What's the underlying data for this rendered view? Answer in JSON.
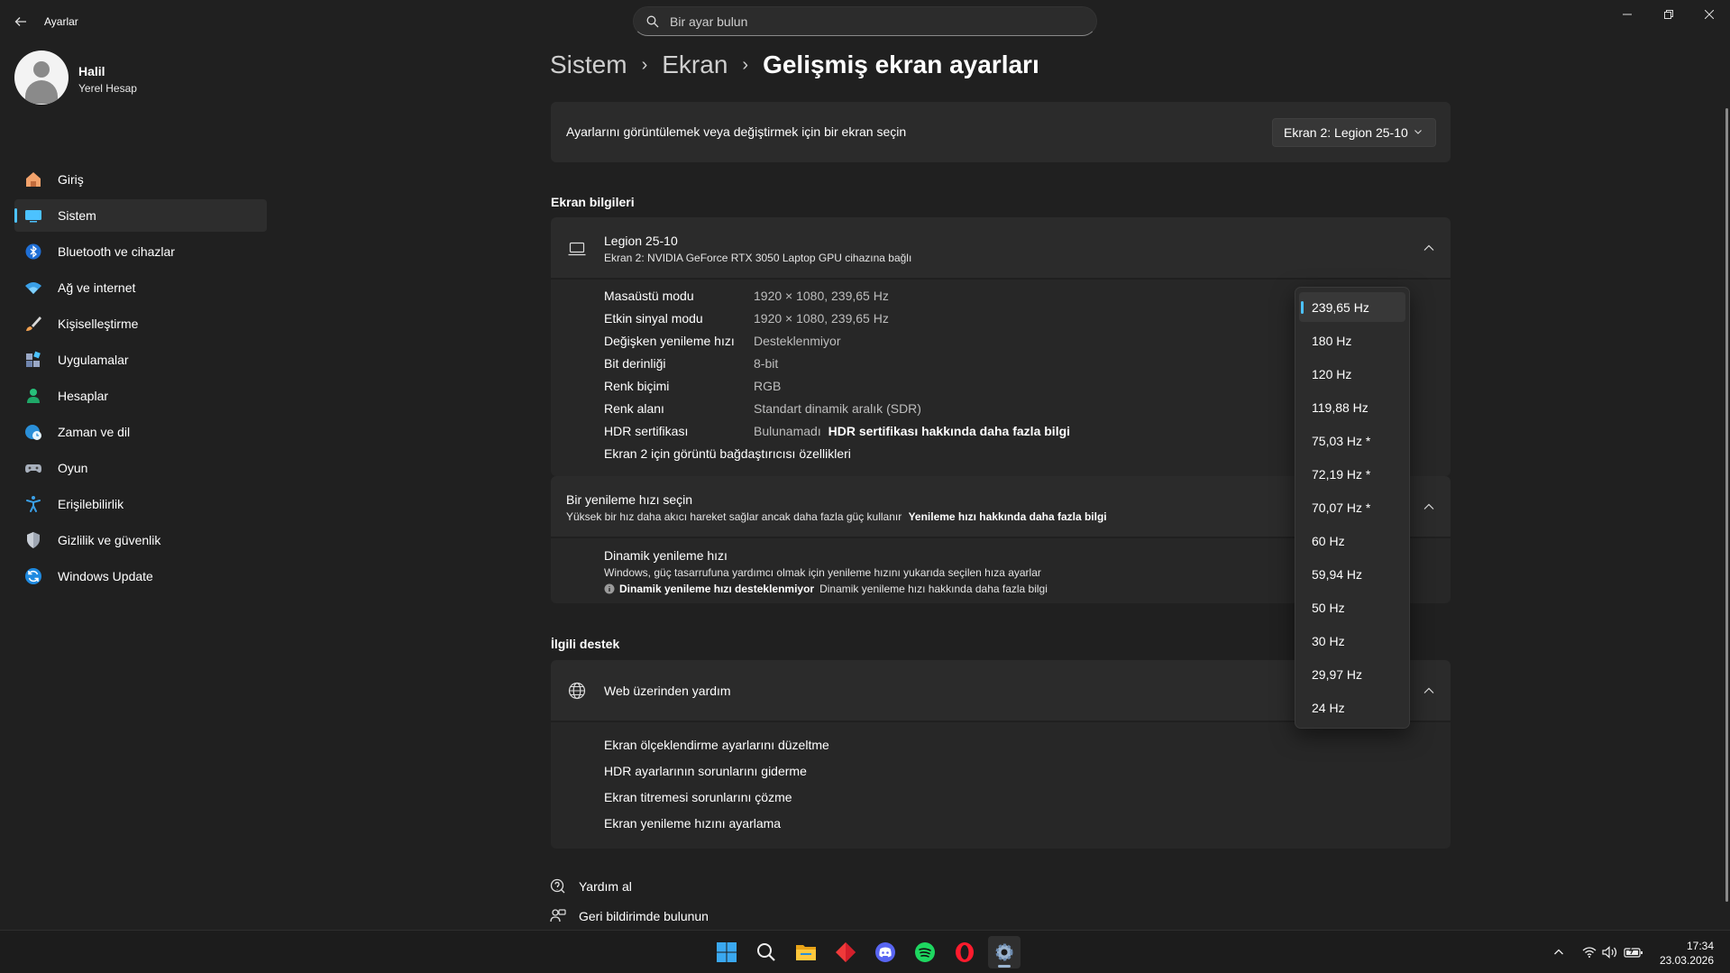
{
  "window": {
    "title": "Ayarlar",
    "search_placeholder": "Bir ayar bulun"
  },
  "profile": {
    "name": "Halil",
    "account_type": "Yerel Hesap"
  },
  "sidebar": {
    "items": [
      {
        "label": "Giriş",
        "icon": "home-icon"
      },
      {
        "label": "Sistem",
        "icon": "system-icon",
        "active": true
      },
      {
        "label": "Bluetooth ve cihazlar",
        "icon": "bluetooth-icon"
      },
      {
        "label": "Ağ ve internet",
        "icon": "wifi-icon"
      },
      {
        "label": "Kişiselleştirme",
        "icon": "brush-icon"
      },
      {
        "label": "Uygulamalar",
        "icon": "apps-icon"
      },
      {
        "label": "Hesaplar",
        "icon": "person-icon"
      },
      {
        "label": "Zaman ve dil",
        "icon": "globe-clock-icon"
      },
      {
        "label": "Oyun",
        "icon": "gamepad-icon"
      },
      {
        "label": "Erişilebilirlik",
        "icon": "accessibility-icon"
      },
      {
        "label": "Gizlilik ve güvenlik",
        "icon": "shield-icon"
      },
      {
        "label": "Windows Update",
        "icon": "update-icon"
      }
    ]
  },
  "breadcrumb": {
    "level1": "Sistem",
    "level2": "Ekran",
    "current": "Gelişmiş ekran ayarları"
  },
  "display_select": {
    "label": "Ayarlarını görüntülemek veya değiştirmek için bir ekran seçin",
    "value": "Ekran 2: Legion 25-10"
  },
  "display_info": {
    "section_title": "Ekran bilgileri",
    "monitor_name": "Legion 25-10",
    "monitor_desc": "Ekran 2: NVIDIA GeForce RTX 3050 Laptop GPU cihazına bağlı",
    "rows": [
      {
        "label": "Masaüstü modu",
        "value": "1920 × 1080, 239,65 Hz"
      },
      {
        "label": "Etkin sinyal modu",
        "value": "1920 × 1080, 239,65 Hz"
      },
      {
        "label": "Değişken yenileme hızı",
        "value": "Desteklenmiyor"
      },
      {
        "label": "Bit derinliği",
        "value": "8-bit"
      },
      {
        "label": "Renk biçimi",
        "value": "RGB"
      },
      {
        "label": "Renk alanı",
        "value": "Standart dinamik aralık (SDR)"
      },
      {
        "label": "HDR sertifikası",
        "value": "Bulunamadı",
        "link": "HDR sertifikası hakkında daha fazla bilgi"
      }
    ],
    "adapter_link": "Ekran 2 için görüntü bağdaştırıcısı özellikleri"
  },
  "refresh_rate": {
    "title": "Bir yenileme hızı seçin",
    "desc": "Yüksek bir hız daha akıcı hareket sağlar ancak daha fazla güç kullanır",
    "link": "Yenileme hızı hakkında daha fazla bilgi",
    "dynamic_title": "Dinamik yenileme hızı",
    "dynamic_desc": "Windows, güç tasarrufuna yardımcı olmak için yenileme hızını yukarıda seçilen hıza ayarlar",
    "dynamic_status": "Dinamik yenileme hızı desteklenmiyor",
    "dynamic_link": "Dinamik yenileme hızı hakkında daha fazla bilgi",
    "options": [
      "239,65 Hz",
      "180 Hz",
      "120 Hz",
      "119,88 Hz",
      "75,03 Hz *",
      "72,19 Hz *",
      "70,07 Hz *",
      "60 Hz",
      "59,94 Hz",
      "50 Hz",
      "30 Hz",
      "29,97 Hz",
      "24 Hz"
    ],
    "selected": "239,65 Hz"
  },
  "related": {
    "section_title": "İlgili destek",
    "web_help": "Web üzerinden yardım",
    "links": [
      "Ekran ölçeklendirme ayarlarını düzeltme",
      "HDR ayarlarının sorunlarını giderme",
      "Ekran titremesi sorunlarını çözme",
      "Ekran yenileme hızını ayarlama"
    ]
  },
  "footer": {
    "get_help": "Yardım al",
    "feedback": "Geri bildirimde bulunun"
  },
  "taskbar": {
    "time": "17:34",
    "date": "23.03.2026"
  },
  "colors": {
    "accent": "#4cc2ff",
    "background": "#202020",
    "card": "#2b2b2b"
  }
}
